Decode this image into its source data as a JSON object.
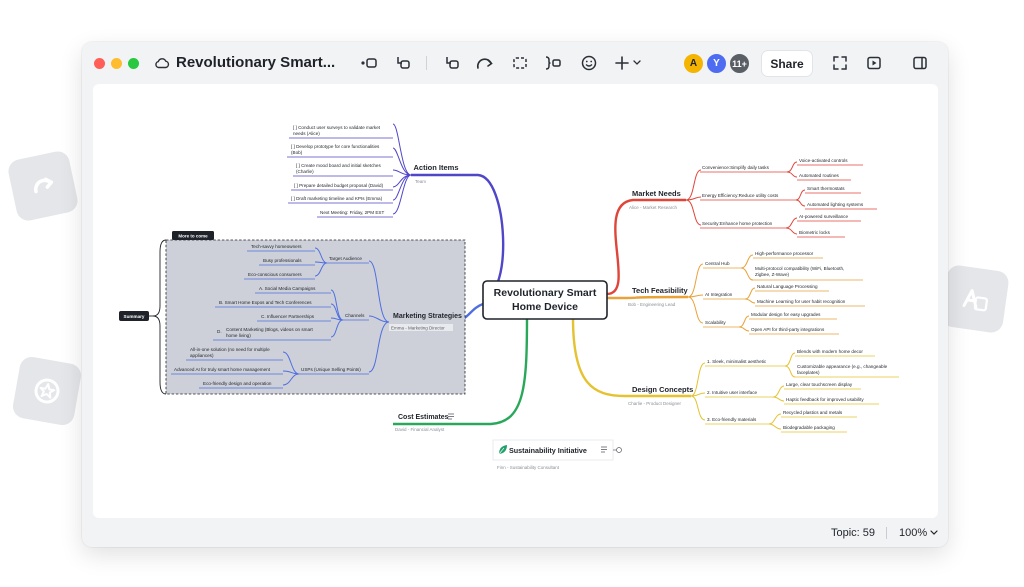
{
  "window": {
    "title": "Revolutionary Smart...",
    "share_label": "Share",
    "avatars": [
      {
        "label": "A",
        "color": "#f5b400"
      },
      {
        "label": "Y",
        "color": "#4d6cf2"
      },
      {
        "label": "11+",
        "color": "#5a5f66"
      }
    ]
  },
  "status": {
    "topic": "Topic: 59",
    "zoom": "100%"
  },
  "map": {
    "root": "Revolutionary Smart Home Device",
    "root_line1": "Revolutionary Smart",
    "root_line2": "Home Device",
    "colors": {
      "action": "#4f46c8",
      "market": "#e0453a",
      "tech": "#e8a23a",
      "design": "#e5c22f",
      "marketing": "#4f6fe0",
      "cost": "#2aa85a",
      "sustain": "#22a06b"
    },
    "action_items": {
      "label": "Action Items",
      "owner": "Team",
      "items": [
        "[ ] Conduct user surveys to validate market",
        "needs (Alice)",
        "[ ] Develop prototype for core functionalities",
        "(Bob)",
        "[ ] Create mood board and initial sketches",
        "(Charlie)",
        "[ ] Prepare detailed budget proposal (David)",
        "[ ] Draft marketing timeline and KPIs (Emma)",
        "Next Meeting: Friday, 2PM EST"
      ]
    },
    "market_needs": {
      "label": "Market Needs",
      "owner": "Alice - Market Research",
      "subs": [
        {
          "label": "Convenience:Simplify daily tasks",
          "leaves": [
            "Voice-activated controls",
            "Automated routines"
          ]
        },
        {
          "label": "Energy Efficiency:Reduce utility costs",
          "leaves": [
            "Smart thermostats",
            "Automated lighting systems"
          ]
        },
        {
          "label": "Security:Enhance home protection",
          "leaves": [
            "AI-powered surveillance",
            "Biometric locks"
          ]
        }
      ]
    },
    "tech_feasibility": {
      "label": "Tech Feasibility",
      "owner": "Bob - Engineering Lead",
      "subs": [
        {
          "label": "Central Hub",
          "leaves": [
            "High-performance processor",
            "Multi-protocol compatibility (WiFi, Bluetooth,",
            "Zigbee, Z-Wave)"
          ]
        },
        {
          "label": "AI Integration",
          "leaves": [
            "Natural Language Processing",
            "Machine Learning for user habit recognition"
          ]
        },
        {
          "label": "Scalability",
          "leaves": [
            "Modular design for easy upgrades",
            "Open API for third-party integrations"
          ]
        }
      ]
    },
    "design_concepts": {
      "label": "Design Concepts",
      "owner": "Charlie - Product Designer",
      "subs": [
        {
          "label": "1. Sleek, minimalist aesthetic",
          "leaves": [
            "Blends with modern home decor",
            "Customizable appearance (e.g., changeable",
            "faceplates)"
          ]
        },
        {
          "label": "2. Intuitive user interface",
          "leaves": [
            "Large, clear touchscreen display",
            "Haptic feedback for improved usability"
          ]
        },
        {
          "label": "3. Eco-friendly materials",
          "leaves": [
            "Recycled plastics and metals",
            "Biodegradable packaging"
          ]
        }
      ]
    },
    "marketing": {
      "label": "Marketing Strategies",
      "owner": "Emma - Marketing Director",
      "more": "More to come",
      "summary": "Summary",
      "target": {
        "label": "Target Audience",
        "leaves": [
          "Tech-savvy homeowners",
          "Busy professionals",
          "Eco-conscious consumers"
        ]
      },
      "channels": {
        "label": "Channels",
        "leaves": [
          "A.  Social Media Campaigns",
          "B.  Smart Home Expos and Tech Conferences",
          "C.  Influencer Partnerships",
          "D.",
          "Content Marketing (Blogs, videos on smart",
          "home living)"
        ]
      },
      "usps": {
        "label": "USPs (Unique Selling Points)",
        "leaves": [
          "All-in-one solution (no need for multiple",
          "appliances)",
          "Advanced AI for truly smart home management",
          "Eco-friendly design and operation"
        ]
      }
    },
    "cost": {
      "label": "Cost Estimates",
      "owner": "David - Financial Analyst"
    },
    "sustain": {
      "label": "Sustainability Initiative",
      "owner": "Finn - Sustainability Consultant"
    }
  }
}
